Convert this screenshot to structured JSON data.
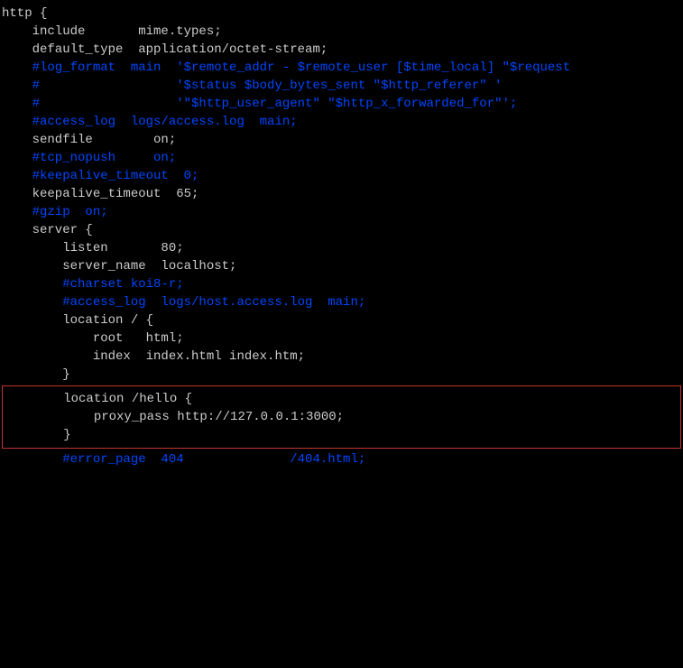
{
  "lines": {
    "l00": "http {",
    "l01": "    include       mime.types;",
    "l02": "    default_type  application/octet-stream;",
    "l03": "",
    "l04": "    #log_format  main  '$remote_addr - $remote_user [$time_local] \"$request",
    "l05": "    #                  '$status $body_bytes_sent \"$http_referer\" '",
    "l06": "    #                  '\"$http_user_agent\" \"$http_x_forwarded_for\"';",
    "l07": "",
    "l08": "    #access_log  logs/access.log  main;",
    "l09": "",
    "l10": "    sendfile        on;",
    "l11": "    #tcp_nopush     on;",
    "l12": "",
    "l13": "    #keepalive_timeout  0;",
    "l14": "    keepalive_timeout  65;",
    "l15": "",
    "l16": "    #gzip  on;",
    "l17": "",
    "l18": "    server {",
    "l19": "        listen       80;",
    "l20": "        server_name  localhost;",
    "l21": "",
    "l22": "        #charset koi8-r;",
    "l23": "",
    "l24": "        #access_log  logs/host.access.log  main;",
    "l25": "",
    "l26": "        location / {",
    "l27": "            root   html;",
    "l28": "            index  index.html index.htm;",
    "l29": "        }",
    "l30": "",
    "l31": "        location /hello {",
    "l32": "            proxy_pass http://127.0.0.1:3000;",
    "l33": "        }",
    "l34": "",
    "l35": "        #error_page  404              /404.html;"
  }
}
